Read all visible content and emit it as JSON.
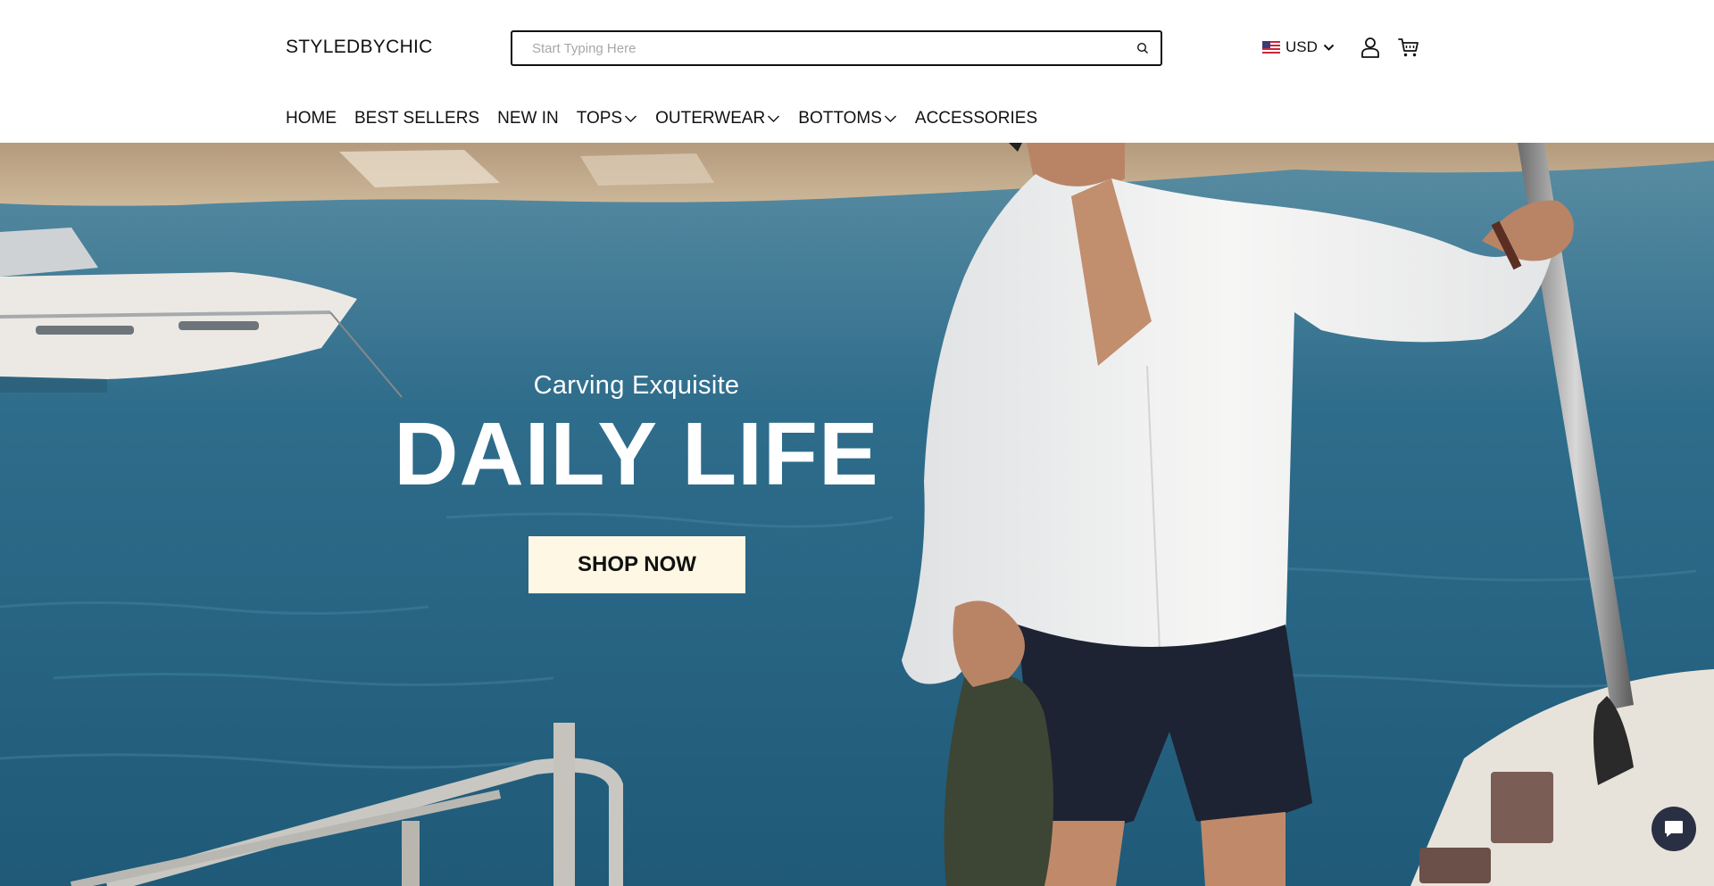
{
  "header": {
    "logo": "STYLEDBYCHIC",
    "search": {
      "placeholder": "Start Typing Here",
      "icon": "search-icon"
    },
    "currency": {
      "code": "USD",
      "flag": "us-flag-icon"
    },
    "account_icon": "user-icon",
    "cart_icon": "cart-icon"
  },
  "nav": [
    {
      "label": "HOME",
      "dropdown": false
    },
    {
      "label": "BEST SELLERS",
      "dropdown": false
    },
    {
      "label": "NEW IN",
      "dropdown": false
    },
    {
      "label": "TOPS",
      "dropdown": true
    },
    {
      "label": "OUTERWEAR",
      "dropdown": true
    },
    {
      "label": "BOTTOMS",
      "dropdown": true
    },
    {
      "label": "ACCESSORIES",
      "dropdown": false
    }
  ],
  "hero": {
    "eyebrow": "Carving Exquisite",
    "headline": "DAILY LIFE",
    "cta": "SHOP NOW",
    "cta_color": "#fdf7e3",
    "text_color": "#ffffff"
  },
  "chat_widget": {
    "icon": "chat-icon",
    "color": "#2a3044"
  },
  "colors": {
    "sea": "#2d6a8a",
    "header_bg": "#ffffff",
    "text": "#111111"
  }
}
